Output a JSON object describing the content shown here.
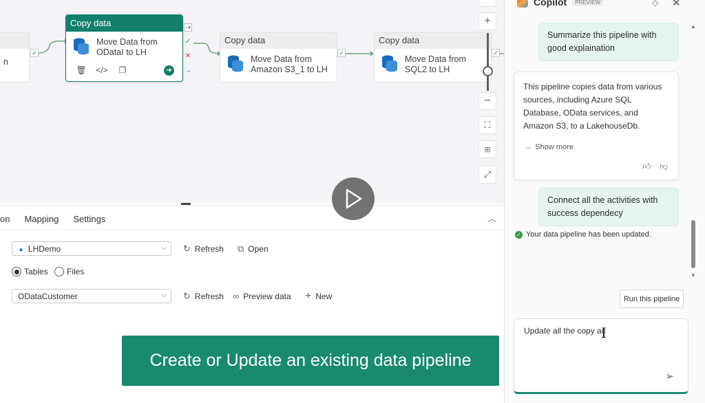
{
  "canvas": {
    "nodes": [
      {
        "header": "",
        "text": "n"
      },
      {
        "header": "Copy data",
        "text": "Move Data from ODataI to LH"
      },
      {
        "header": "Copy data",
        "text": "Move Data from Amazon S3_1 to LH"
      },
      {
        "header": "Copy data",
        "text": "Move Data from SQL2 to LH"
      }
    ],
    "zoom_icons": [
      "plus-icon",
      "minus-icon",
      "fit-icon",
      "auto-layout-icon",
      "expand-icon"
    ]
  },
  "panel": {
    "tabs": [
      "on",
      "Mapping",
      "Settings"
    ],
    "connection": {
      "value": "LHDemo"
    },
    "refresh_label": "Refresh",
    "open_label": "Open",
    "radio": {
      "tables": "Tables",
      "files": "Files",
      "selected": "Tables"
    },
    "table": {
      "value": "ODataCustomer"
    },
    "preview_label": "Preview data",
    "new_label": "New"
  },
  "banner": {
    "text": "Create or Update an existing data pipeline"
  },
  "copilot": {
    "title": "Copilot",
    "badge": "PREVIEW",
    "messages": {
      "user1": "Summarize this pipeline with good explaination",
      "bot1": "This pipeline copies data from various sources, including Azure SQL Database, OData services, and Amazon S3, to a LakehouseDb.",
      "show_more": "Show more",
      "user2": "Connect all the activities with success dependecy",
      "status": "Your data pipeline has been updated."
    },
    "run_button": "Run this pipeline",
    "input": {
      "value": "Update all the copy ac"
    }
  },
  "colors": {
    "accent": "#13806b",
    "banner": "#198a6e",
    "user_bubble": "#e6f4ef"
  }
}
